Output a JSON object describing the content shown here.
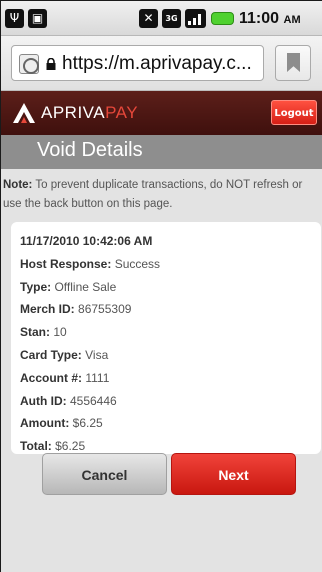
{
  "status": {
    "clock": "11:00",
    "ampm": "AM",
    "network": "3G",
    "icons": [
      "usb-icon",
      "sd-card-icon",
      "mute-icon",
      "3g-icon",
      "signal-icon",
      "battery-icon"
    ]
  },
  "browser": {
    "url": "https://m.aprivapay.c..."
  },
  "brand": {
    "name_a": "APRIVA",
    "name_b": "PAY",
    "logout_label": "Logout"
  },
  "page": {
    "title": "Void Details",
    "note_label": "Note:",
    "note_text": " To prevent duplicate transactions, do NOT refresh or use the back button on this page."
  },
  "details": {
    "datetime": "11/17/2010 10:42:06 AM",
    "rows": [
      {
        "label": "Host Response:",
        "value": " Success"
      },
      {
        "label": "Type:",
        "value": " Offline Sale"
      },
      {
        "label": "Merch ID:",
        "value": " 86755309"
      },
      {
        "label": "Stan:",
        "value": " 10"
      },
      {
        "label": "Card Type:",
        "value": " Visa"
      },
      {
        "label": "Account #:",
        "value": " 1111"
      },
      {
        "label": "Auth ID:",
        "value": " 4556446"
      },
      {
        "label": "Amount:",
        "value": " $6.25"
      },
      {
        "label": "Total:",
        "value": " $6.25"
      }
    ]
  },
  "actions": {
    "cancel_label": "Cancel",
    "next_label": "Next"
  },
  "colors": {
    "brand_dark": "#4a1512",
    "accent_red": "#e0241b",
    "battery_green": "#4fd12f"
  }
}
